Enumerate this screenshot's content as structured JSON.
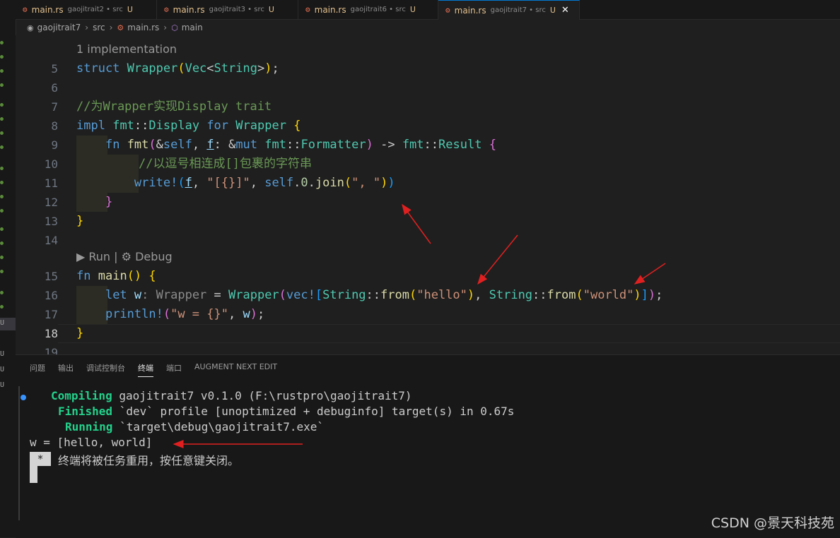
{
  "tabs": [
    {
      "name": "main.rs",
      "desc": "gaojitrait2 • src",
      "status": "U",
      "active": false
    },
    {
      "name": "main.rs",
      "desc": "gaojitrait3 • src",
      "status": "U",
      "active": false
    },
    {
      "name": "main.rs",
      "desc": "gaojitrait6 • src",
      "status": "U",
      "active": false
    },
    {
      "name": "main.rs",
      "desc": "gaojitrait7 • src",
      "status": "U",
      "active": true,
      "close": "✕"
    }
  ],
  "breadcrumb": [
    "gaojitrait7",
    "src",
    "main.rs",
    "main"
  ],
  "editor": {
    "codelens_impl": "1 implementation",
    "codelens_run": "▶ Run",
    "codelens_sep": "|",
    "codelens_debug": "⚙ Debug",
    "line_numbers": [
      "5",
      "6",
      "7",
      "8",
      "9",
      "10",
      "11",
      "12",
      "13",
      "14",
      "15",
      "16",
      "17",
      "18",
      "19"
    ],
    "current_line": "18",
    "comment_display": "//为Wrapper实现Display trait",
    "comment_join": "//以逗号相连成[]包裹的字符串",
    "type_hint": ": Wrapper"
  },
  "panel": {
    "tabs": [
      "问题",
      "输出",
      "调试控制台",
      "终端",
      "端口",
      "AUGMENT NEXT EDIT"
    ],
    "active_tab": "终端",
    "terminal": [
      {
        "label": "Compiling",
        "text": " gaojitrait7 v0.1.0 (F:\\rustpro\\gaojitrait7)"
      },
      {
        "label": "Finished",
        "text": " `dev` profile [unoptimized + debuginfo] target(s) in 0.67s"
      },
      {
        "label": "Running",
        "text": " `target\\debug\\gaojitrait7.exe`"
      }
    ],
    "output": "w = [hello, world]",
    "reuse_star": "*",
    "reuse_msg": "终端将被任务重用，按任意键关闭。"
  },
  "watermark": "CSDN @景天科技苑",
  "colors": {
    "accent": "#0078d4",
    "annotation_arrow": "#e02020",
    "terminal_green": "#23d18b"
  }
}
